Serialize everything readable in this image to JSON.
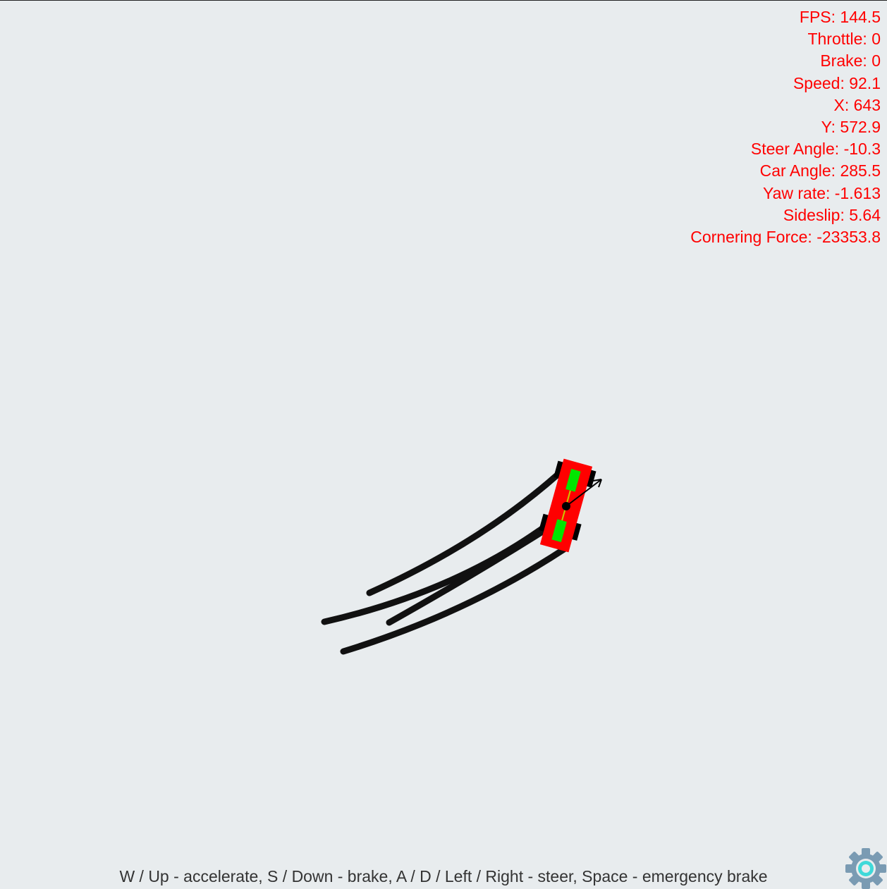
{
  "hud": {
    "fps": "FPS: 144.5",
    "throttle": "Throttle: 0",
    "brake": "Brake: 0",
    "speed": "Speed: 92.1",
    "x": "X: 643",
    "y": "Y: 572.9",
    "steer_angle": "Steer Angle: -10.3",
    "car_angle": "Car Angle: 285.5",
    "yaw_rate": "Yaw rate: -1.613",
    "sideslip": "Sideslip: 5.64",
    "cornering_force": "Cornering Force: -23353.8"
  },
  "help_text": "W / Up - accelerate, S / Down - brake, A / D / Left / Right - steer, Space - emergency brake",
  "settings": {
    "icon": "gear-icon"
  },
  "colors": {
    "background": "#e8ecee",
    "hud_text": "#ff0000",
    "car_body": "#ff0000",
    "car_windows": "#00e600",
    "wheels": "#000000",
    "skid_marks": "#111111",
    "gear": "#7a9bb3"
  }
}
